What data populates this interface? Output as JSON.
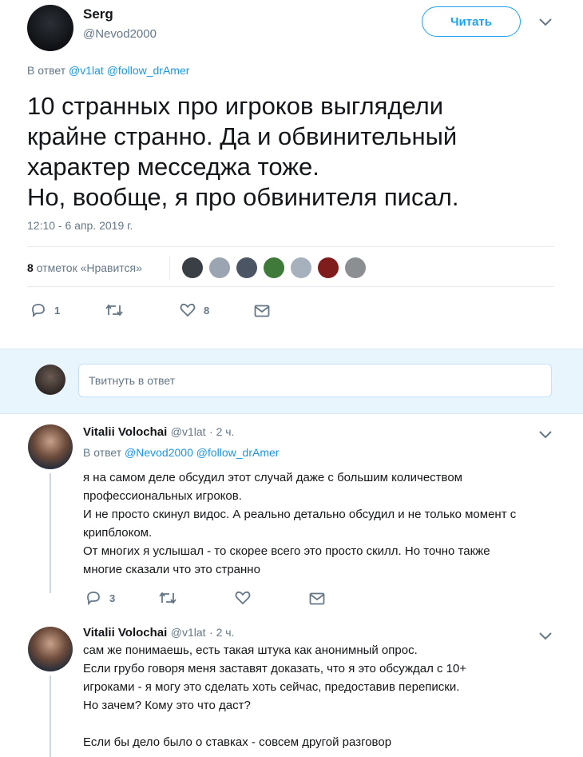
{
  "main_tweet": {
    "author_name": "Serg",
    "author_handle": "@Nevod2000",
    "follow_label": "Читать",
    "reply_prefix": "В ответ",
    "reply_to_1": "@v1lat",
    "reply_to_2": "@follow_drAmer",
    "text_lines": [
      "10 странных про игроков выглядели",
      "крайне странно. Да и обвинительный",
      "характер месседжа тоже.",
      "Но, вообще, я про обвинителя писал."
    ],
    "timestamp": "12:10 - 6 апр. 2019 г.",
    "likes_count": "8",
    "likes_label": "отметок «Нравится»",
    "liker_colors": [
      "#3a3f45",
      "#9aa5b1",
      "#4b5563",
      "#3f7a3a",
      "#a7b1bd",
      "#7f1d1d",
      "#8c8f92"
    ],
    "actions": {
      "replies": "1",
      "retweets": "",
      "likes": "8"
    }
  },
  "reply_box": {
    "placeholder": "Твитнуть в ответ"
  },
  "replies": [
    {
      "author_name": "Vitalii Volochai",
      "author_handle": "@v1lat",
      "time": "· 2 ч.",
      "reply_prefix": "В ответ",
      "reply_to_1": "@Nevod2000",
      "reply_to_2": "@follow_drAmer",
      "lines": [
        "я на самом деле обсудил этот случай даже с большим количеством",
        "профессиональных игроков.",
        "И не просто скинул видос. А реально детально обсудил и не только момент с",
        "крипблоком.",
        "От многих я услышал - то скорее всего это просто скилл. Но точно также",
        "многие сказали что это странно"
      ],
      "actions": {
        "replies": "3",
        "retweets": "",
        "likes": ""
      }
    },
    {
      "author_name": "Vitalii Volochai",
      "author_handle": "@v1lat",
      "time": "· 2 ч.",
      "lines": [
        "сам же понимаешь, есть такая штука как анонимный опрос.",
        "Если грубо говоря меня заставят доказать, что я это обсуждал с 10+",
        "игроками - я могу это сделать хоть сейчас, предоставив переписки.",
        "Но зачем? Кому это что даст?",
        "",
        "Если бы дело было о ставках - совсем другой разговор"
      ]
    }
  ]
}
